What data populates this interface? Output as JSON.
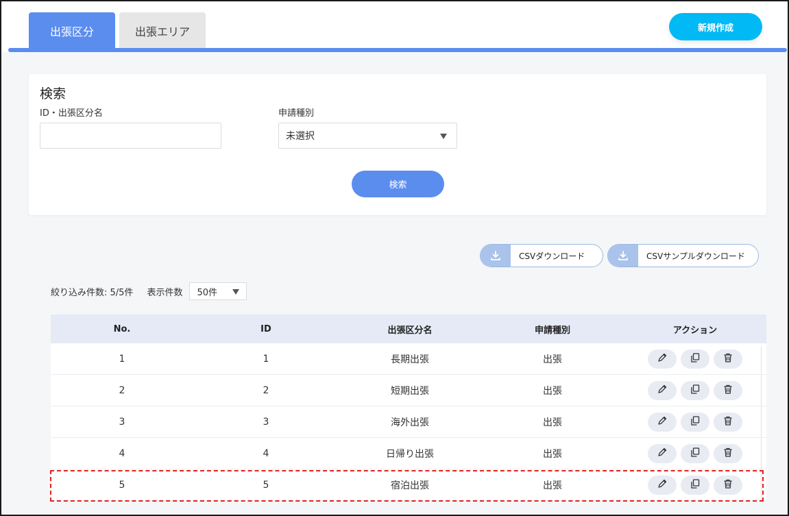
{
  "tabs": [
    {
      "label": "出張区分",
      "active": true
    },
    {
      "label": "出張エリア",
      "active": false
    }
  ],
  "new_button": "新規作成",
  "search": {
    "title": "検索",
    "id_label": "ID・出張区分名",
    "id_value": "",
    "type_label": "申請種別",
    "type_value": "未選択",
    "button": "検索"
  },
  "csv": {
    "download": "CSVダウンロード",
    "sample_download": "CSVサンプルダウンロード"
  },
  "filter": {
    "count_label": "絞り込み件数: 5/5件",
    "per_page_label": "表示件数",
    "per_page_value": "50件"
  },
  "table": {
    "headers": {
      "no": "No.",
      "id": "ID",
      "name": "出張区分名",
      "type": "申請種別",
      "action": "アクション"
    },
    "rows": [
      {
        "no": "1",
        "id": "1",
        "name": "長期出張",
        "type": "出張"
      },
      {
        "no": "2",
        "id": "2",
        "name": "短期出張",
        "type": "出張"
      },
      {
        "no": "3",
        "id": "3",
        "name": "海外出張",
        "type": "出張"
      },
      {
        "no": "4",
        "id": "4",
        "name": "日帰り出張",
        "type": "出張"
      },
      {
        "no": "5",
        "id": "5",
        "name": "宿泊出張",
        "type": "出張"
      }
    ]
  },
  "icons": {
    "edit": "pencil-icon",
    "copy": "copy-icon",
    "delete": "trash-icon",
    "download": "download-icon"
  },
  "colors": {
    "primary": "#5b8def",
    "new_button": "#00b9f5",
    "highlight": "#e02020"
  }
}
